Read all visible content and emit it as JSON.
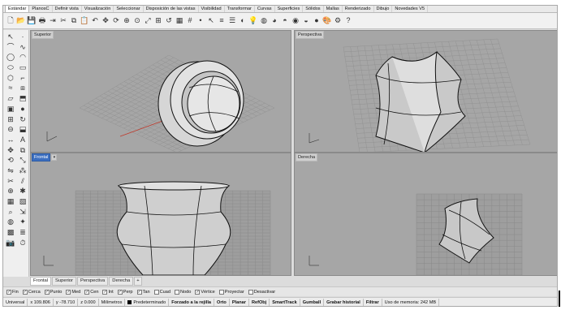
{
  "tabs": [
    "Estándar",
    "PlanosC",
    "Definir vista",
    "Visualización",
    "Seleccionar",
    "Disposición de las vistas",
    "Visibilidad",
    "Transformar",
    "Curvas",
    "Superficies",
    "Sólidos",
    "Mallas",
    "Renderizado",
    "Dibujo",
    "Novedades V5"
  ],
  "toolbar_icons": [
    "new-file-icon",
    "open-file-icon",
    "save-icon",
    "print-icon",
    "import-icon",
    "cut-icon",
    "copy-icon",
    "paste-icon",
    "undo-icon",
    "pan-icon",
    "rotate-view-icon",
    "zoom-window-icon",
    "zoom-dynamic-icon",
    "zoom-extents-icon",
    "zoom-selected-icon",
    "undo-view-icon",
    "four-viewports-icon",
    "grid-icon",
    "point-icon",
    "select-icon",
    "layer-icon",
    "properties-icon",
    "shaded-icon",
    "lights-icon",
    "render-icon",
    "material-icon",
    "environment-icon",
    "boolean-union-icon",
    "boolean-diff-icon",
    "sphere-icon",
    "paint-icon",
    "options-icon",
    "help-icon"
  ],
  "palette_icons": [
    "select-arrow-icon",
    "point-tool-icon",
    "polyline-icon",
    "curve-tool-icon",
    "circle-icon",
    "arc-icon",
    "ellipse-icon",
    "rectangle-icon",
    "polygon-icon",
    "fillet-icon",
    "free-curve-icon",
    "offset-icon",
    "surface-icon",
    "extrude-icon",
    "box-icon",
    "sphere-tool-icon",
    "mesh-icon",
    "revolve-icon",
    "boolean-icon",
    "shell-icon",
    "dimension-icon",
    "text-icon",
    "move-icon",
    "copy-tool-icon",
    "rotate-icon",
    "scale-icon",
    "mirror-icon",
    "array-icon",
    "trim-icon",
    "split-icon",
    "join-icon",
    "explode-icon",
    "group-icon",
    "ungroup-icon",
    "analyze-icon",
    "transform-icon",
    "render-tool-icon",
    "light-tool-icon",
    "block-icon",
    "layer-tool-icon",
    "snapshot-icon",
    "history-icon"
  ],
  "viewports": {
    "top_left": {
      "title": "Superior",
      "active": false
    },
    "top_right": {
      "title": "Perspectiva",
      "active": false
    },
    "bottom_left": {
      "title": "Frontal",
      "active": true
    },
    "bottom_right": {
      "title": "Derecha",
      "active": false
    }
  },
  "viewport_tabs": [
    "Frontal",
    "Superior",
    "Perspectiva",
    "Derecha"
  ],
  "viewport_tab_plus": "+",
  "osnaps": [
    {
      "label": "Fin",
      "checked": true
    },
    {
      "label": "Cerca",
      "checked": true
    },
    {
      "label": "Punto",
      "checked": true
    },
    {
      "label": "Med",
      "checked": true
    },
    {
      "label": "Cen",
      "checked": true
    },
    {
      "label": "Int",
      "checked": true
    },
    {
      "label": "Perp",
      "checked": true
    },
    {
      "label": "Tan",
      "checked": true
    },
    {
      "label": "Cuad",
      "checked": false
    },
    {
      "label": "Nodo",
      "checked": false
    },
    {
      "label": "Vértice",
      "checked": true
    },
    {
      "label": "Proyectar",
      "checked": false
    },
    {
      "label": "Desactivar",
      "checked": false
    }
  ],
  "status": {
    "cplane": "Universal",
    "x": "x 109.806",
    "y": "y -78.710",
    "z": "z 0.000",
    "units": "Milímetros",
    "layer": "Predeterminado",
    "toggles": [
      "Forzado a la rejilla",
      "Orto",
      "Planar",
      "RefObj",
      "SmartTrack",
      "Gumball",
      "Grabar historial",
      "Filtrar"
    ],
    "memory": "Uso de memoria: 242 MB"
  },
  "colors": {
    "active_viewport": "#3c6fc0",
    "viewport_bg": "#a6a6a6",
    "grid": "#8f8f8f",
    "x_axis": "#c0392b",
    "y_axis": "#27ae60"
  }
}
